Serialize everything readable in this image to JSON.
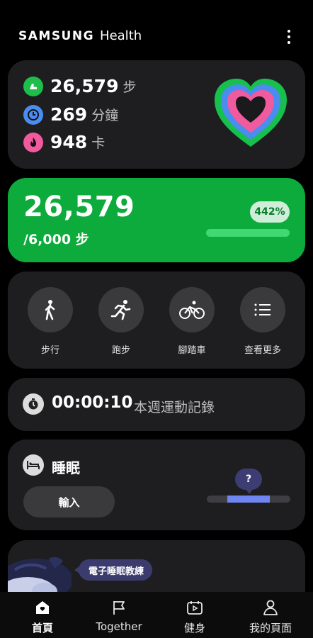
{
  "header": {
    "brand_samsung": "SAMSUNG",
    "brand_health": "Health",
    "more_icon": "more-vertical-icon"
  },
  "summary": {
    "steps_value": "26,579",
    "steps_unit": "步",
    "minutes_value": "269",
    "minutes_unit": "分鐘",
    "calories_value": "948",
    "calories_unit": "卡",
    "colors": {
      "steps": "#1fbe4c",
      "minutes": "#4a8cf0",
      "calories": "#f05a9e"
    }
  },
  "steps_card": {
    "count": "26,579",
    "goal": "/6,000 步",
    "percent": "442%",
    "progress": 1.0,
    "color": "#0daa3c"
  },
  "quick_actions": [
    {
      "label": "步行",
      "icon": "walking-icon"
    },
    {
      "label": "跑步",
      "icon": "running-icon"
    },
    {
      "label": "腳踏車",
      "icon": "cycling-icon"
    },
    {
      "label": "查看更多",
      "icon": "list-icon"
    }
  ],
  "timer": {
    "time": "00:00:10",
    "label": "本週運動記錄"
  },
  "sleep": {
    "title": "睡眠",
    "input_label": "輸入",
    "unknown_marker": "?"
  },
  "coach": {
    "tag": "電子睡眠教練"
  },
  "bottom_nav": [
    {
      "label": "首頁",
      "icon": "home-icon",
      "active": true
    },
    {
      "label": "Together",
      "icon": "flag-icon",
      "active": false
    },
    {
      "label": "健身",
      "icon": "video-icon",
      "active": false
    },
    {
      "label": "我的頁面",
      "icon": "person-icon",
      "active": false
    }
  ]
}
